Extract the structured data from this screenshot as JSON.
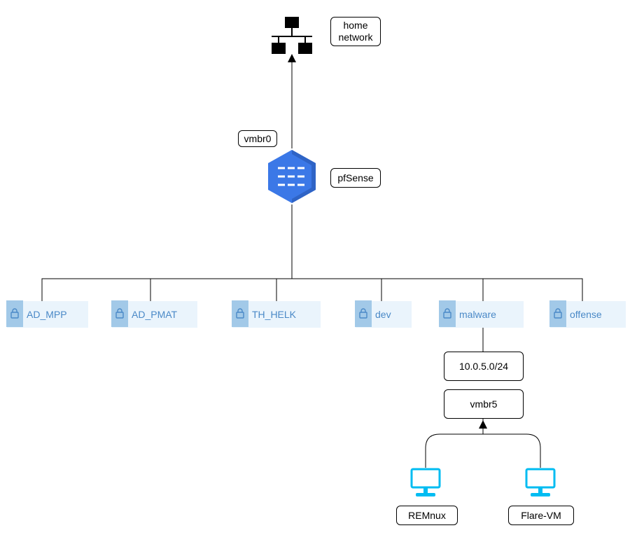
{
  "top": {
    "label": "home\nnetwork",
    "interface": "vmbr0",
    "router": "pfSense"
  },
  "subnets": [
    {
      "name": "AD_MPP"
    },
    {
      "name": "AD_PMAT"
    },
    {
      "name": "TH_HELK"
    },
    {
      "name": "dev"
    },
    {
      "name": "malware"
    },
    {
      "name": "offense"
    }
  ],
  "malware_detail": {
    "cidr": "10.0.5.0/24",
    "bridge": "vmbr5",
    "hosts": [
      {
        "name": "REMnux"
      },
      {
        "name": "Flare-VM"
      }
    ]
  },
  "colors": {
    "subnet_text": "#4a89c7",
    "subnet_bg": "#eaf4fc",
    "lock_bg": "#a2c9e8",
    "firewall": "#3b78e7",
    "computer": "#00bcf2"
  }
}
